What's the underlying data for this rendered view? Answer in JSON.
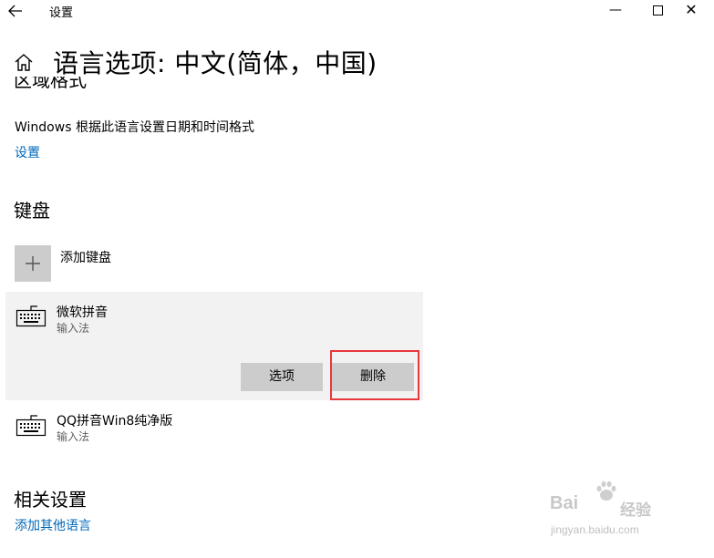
{
  "titlebar": {
    "back_icon": "arrow-left-icon",
    "app_title": "设置",
    "minimize_glyph": "—",
    "close_glyph": "✕"
  },
  "header": {
    "home_icon": "home-icon",
    "page_title": "语言选项: 中文(简体，中国)"
  },
  "region": {
    "heading": "区域格式",
    "description": "Windows 根据此语言设置日期和时间格式",
    "settings_link": "设置"
  },
  "keyboards": {
    "heading": "键盘",
    "add_label": "添加键盘",
    "items": [
      {
        "name": "微软拼音",
        "type": "输入法",
        "icon": "keyboard-icon"
      },
      {
        "name": "QQ拼音Win8纯净版",
        "type": "输入法",
        "icon": "keyboard-icon"
      }
    ],
    "options_button": "选项",
    "remove_button": "删除",
    "highlight_color": "#e8383d"
  },
  "related": {
    "heading": "相关设置",
    "add_language_link": "添加其他语言"
  },
  "watermark": {
    "brand": "Bai",
    "brand2": "经验",
    "url": "jingyan.baidu.com"
  },
  "colors": {
    "link": "#0067b8",
    "panel_bg": "#f2f2f2",
    "button_bg": "#cccccc"
  }
}
